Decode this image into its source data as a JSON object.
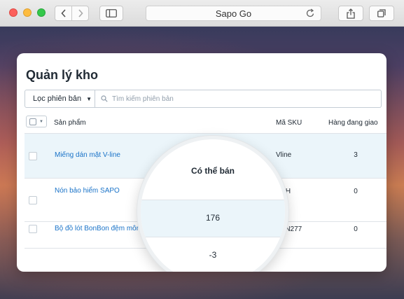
{
  "browser": {
    "address": "Sapo Go"
  },
  "page": {
    "title": "Quản lý kho",
    "filter_label": "Lọc phiên bản",
    "search_placeholder": "Tìm kiếm phiên bản"
  },
  "table": {
    "columns": {
      "product": "Sản phẩm",
      "available": "Có thể bán",
      "sku": "Mã SKU",
      "shipping": "Hàng đang giao"
    },
    "rows": [
      {
        "name": "Miếng dán mặt V-line",
        "available": "176",
        "sku": "Vline",
        "shipping": "3"
      },
      {
        "name": "Nón bảo hiểm SAPO",
        "available": "-3",
        "sku": "NBH",
        "shipping": "0"
      },
      {
        "name": "Bộ đồ lót BonBon đệm mông",
        "available": "",
        "sku": "PVN277",
        "shipping": "0"
      }
    ]
  },
  "colors": {
    "link": "#1a73c8",
    "selected_row": "#ebf5fa"
  }
}
